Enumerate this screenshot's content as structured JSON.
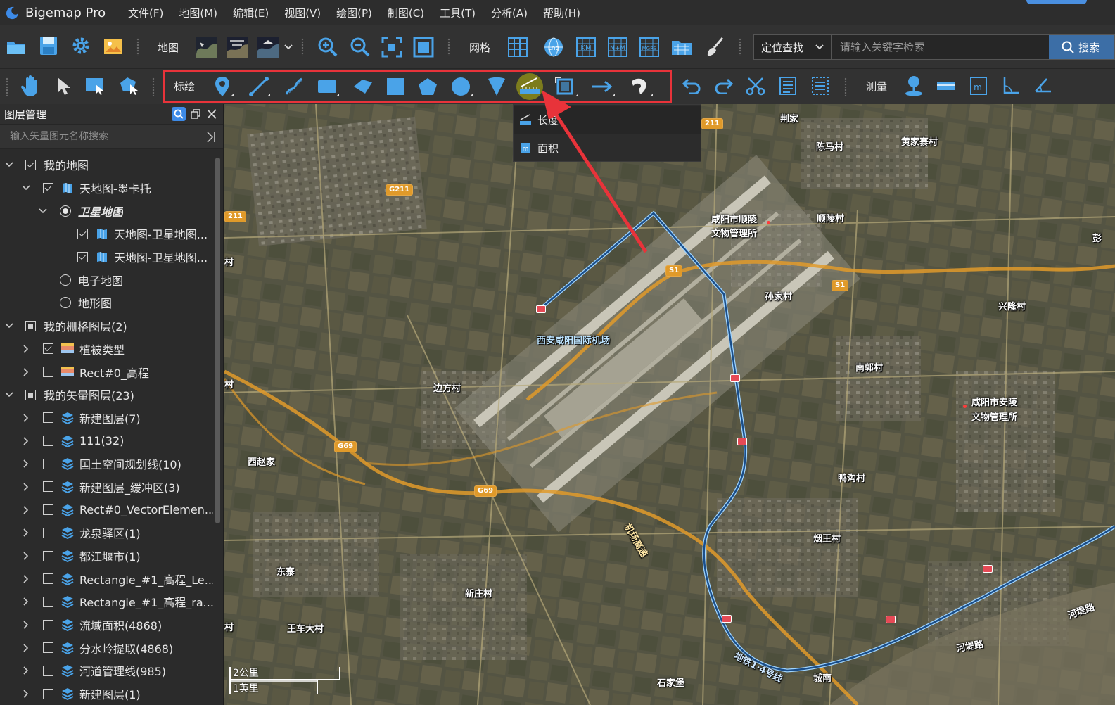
{
  "app": {
    "title": "Bigemap Pro",
    "menu": [
      "文件(F)",
      "地图(M)",
      "编辑(E)",
      "视图(V)",
      "绘图(P)",
      "制图(C)",
      "工具(T)",
      "分析(A)",
      "帮助(H)"
    ]
  },
  "toolbar1": {
    "map_label": "地图",
    "grid_label": "网格",
    "search_mode": "定位查找",
    "search_placeholder": "请输入关键字检索",
    "search_button": "搜索",
    "grid_icon_texts": [
      "Lng",
      "KM",
      "N+M",
      "MGRS"
    ]
  },
  "toolbar2": {
    "draw_label": "标绘",
    "measure_label": "测量"
  },
  "measure_menu": {
    "items": [
      "长度",
      "面积"
    ]
  },
  "layer_panel": {
    "title": "图层管理",
    "search_placeholder": "输入矢量图元名称搜索",
    "tree": [
      {
        "label": "我的地图",
        "level": 0,
        "arrow": "down",
        "ctrl": "check",
        "state": "checked",
        "icon": ""
      },
      {
        "label": "天地图-墨卡托",
        "level": 1,
        "arrow": "down",
        "ctrl": "check",
        "state": "checked",
        "icon": "map"
      },
      {
        "label": "卫星地图",
        "level": 2,
        "arrow": "down",
        "ctrl": "radio",
        "state": "on",
        "icon": "",
        "style": "bold-italic"
      },
      {
        "label": "天地图-卫星地图...",
        "level": 3,
        "arrow": "",
        "ctrl": "check",
        "state": "checked",
        "icon": "map"
      },
      {
        "label": "天地图-卫星地图...",
        "level": 3,
        "arrow": "",
        "ctrl": "check",
        "state": "checked",
        "icon": "map"
      },
      {
        "label": "电子地图",
        "level": 2,
        "arrow": "",
        "ctrl": "radio",
        "state": "off",
        "icon": ""
      },
      {
        "label": "地形图",
        "level": 2,
        "arrow": "",
        "ctrl": "radio",
        "state": "off",
        "icon": ""
      },
      {
        "label": "我的栅格图层(2)",
        "level": 0,
        "arrow": "down",
        "ctrl": "check",
        "state": "partial",
        "icon": ""
      },
      {
        "label": "植被类型",
        "level": 1,
        "arrow": "right",
        "ctrl": "check",
        "state": "checked",
        "icon": "raster"
      },
      {
        "label": "Rect#0_高程",
        "level": 1,
        "arrow": "right",
        "ctrl": "check",
        "state": "unchecked",
        "icon": "raster"
      },
      {
        "label": "我的矢量图层(23)",
        "level": 0,
        "arrow": "down",
        "ctrl": "check",
        "state": "partial",
        "icon": ""
      },
      {
        "label": "新建图层(7)",
        "level": 1,
        "arrow": "right",
        "ctrl": "check",
        "state": "unchecked",
        "icon": "layers"
      },
      {
        "label": "111(32)",
        "level": 1,
        "arrow": "right",
        "ctrl": "check",
        "state": "unchecked",
        "icon": "layers"
      },
      {
        "label": "国土空间规划线(10)",
        "level": 1,
        "arrow": "right",
        "ctrl": "check",
        "state": "unchecked",
        "icon": "layers"
      },
      {
        "label": "新建图层_缓冲区(3)",
        "level": 1,
        "arrow": "right",
        "ctrl": "check",
        "state": "unchecked",
        "icon": "layers"
      },
      {
        "label": "Rect#0_VectorElemen...",
        "level": 1,
        "arrow": "right",
        "ctrl": "check",
        "state": "unchecked",
        "icon": "layers"
      },
      {
        "label": "龙泉驿区(1)",
        "level": 1,
        "arrow": "right",
        "ctrl": "check",
        "state": "unchecked",
        "icon": "layers"
      },
      {
        "label": "都江堰市(1)",
        "level": 1,
        "arrow": "right",
        "ctrl": "check",
        "state": "unchecked",
        "icon": "layers"
      },
      {
        "label": "Rectangle_#1_高程_Le...",
        "level": 1,
        "arrow": "right",
        "ctrl": "check",
        "state": "unchecked",
        "icon": "layers"
      },
      {
        "label": "Rectangle_#1_高程_ra...",
        "level": 1,
        "arrow": "right",
        "ctrl": "check",
        "state": "unchecked",
        "icon": "layers"
      },
      {
        "label": "流域面积(4868)",
        "level": 1,
        "arrow": "right",
        "ctrl": "check",
        "state": "unchecked",
        "icon": "layers"
      },
      {
        "label": "分水岭提取(4868)",
        "level": 1,
        "arrow": "right",
        "ctrl": "check",
        "state": "unchecked",
        "icon": "layers"
      },
      {
        "label": "河道管理线(985)",
        "level": 1,
        "arrow": "right",
        "ctrl": "check",
        "state": "unchecked",
        "icon": "layers"
      },
      {
        "label": "新建图层(1)",
        "level": 1,
        "arrow": "right",
        "ctrl": "check",
        "state": "unchecked",
        "icon": "layers"
      }
    ]
  },
  "map": {
    "places": [
      "荆家",
      "陈马村",
      "黄家寨村",
      "咸阳市顺陵",
      "文物管理所",
      "顺陵村",
      "孙家村",
      "兴隆村",
      "西安咸阳国际机场",
      "南郭村",
      "边方村",
      "咸阳市安陵",
      "文物管理所",
      "西赵家",
      "鸭沟村",
      "烟王村",
      "东寨",
      "新庄村",
      "王车大村",
      "石家堡",
      "城南",
      "河堤路",
      "河堤路",
      "彭",
      "村",
      "村",
      "村",
      "机场高速",
      "地铁1·4号线"
    ],
    "road_badges": [
      "G211",
      "211",
      "211",
      "S1",
      "S1",
      "G69",
      "G69"
    ],
    "scale": [
      "2公里",
      "1英里"
    ]
  },
  "colors": {
    "highlight": "#e8333a",
    "accent": "#3c6ea6",
    "metro_line": "#1a4e8a",
    "highway": "#e09a2a"
  }
}
